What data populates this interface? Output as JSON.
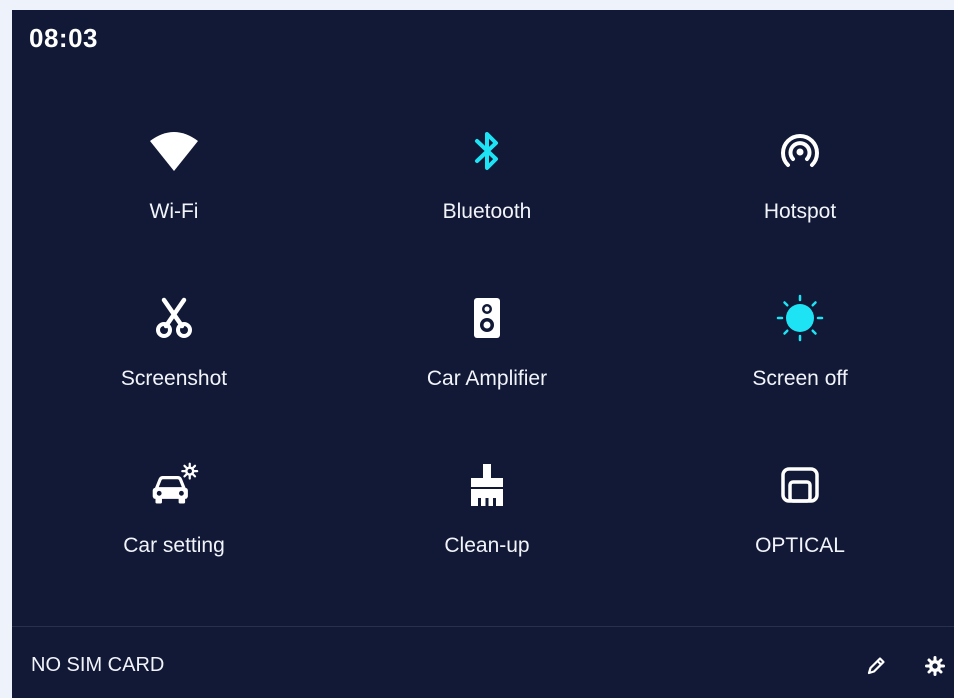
{
  "status": {
    "time": "08:03"
  },
  "tiles": [
    {
      "label": "Wi-Fi",
      "icon": "wifi-icon",
      "active": false
    },
    {
      "label": "Bluetooth",
      "icon": "bluetooth-icon",
      "active": true
    },
    {
      "label": "Hotspot",
      "icon": "hotspot-icon",
      "active": false
    },
    {
      "label": "Screenshot",
      "icon": "scissors-icon",
      "active": false
    },
    {
      "label": "Car Amplifier",
      "icon": "speaker-icon",
      "active": false
    },
    {
      "label": "Screen off",
      "icon": "brightness-icon",
      "active": true
    },
    {
      "label": "Car setting",
      "icon": "car-settings-icon",
      "active": false
    },
    {
      "label": "Clean-up",
      "icon": "broom-icon",
      "active": false
    },
    {
      "label": "OPTICAL",
      "icon": "optical-icon",
      "active": false
    }
  ],
  "footer": {
    "carrier": "NO SIM CARD",
    "edit_icon": "pencil-icon",
    "settings_icon": "gear-icon"
  },
  "colors": {
    "panel_bg": "#111936",
    "active_accent": "#1ee3f5",
    "inactive_icon": "#ffffff"
  }
}
